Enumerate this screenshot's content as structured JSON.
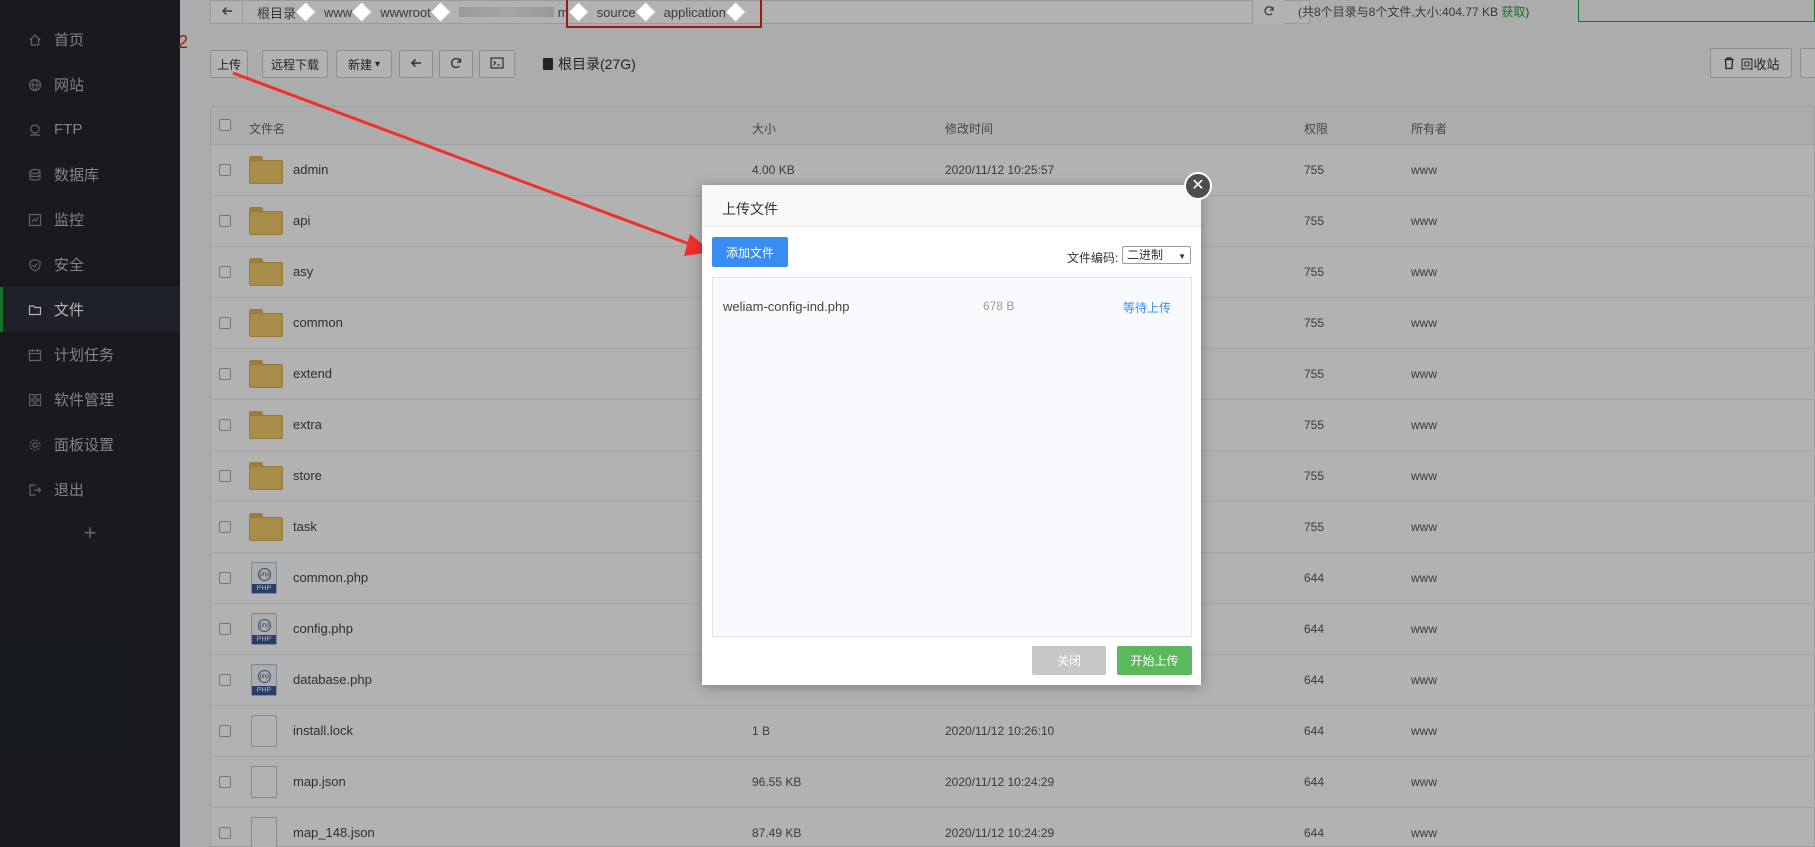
{
  "sidebar": {
    "items": [
      {
        "label": "首页",
        "icon": "home-icon"
      },
      {
        "label": "网站",
        "icon": "globe-icon"
      },
      {
        "label": "FTP",
        "icon": "ftp-icon"
      },
      {
        "label": "数据库",
        "icon": "database-icon"
      },
      {
        "label": "监控",
        "icon": "monitor-icon"
      },
      {
        "label": "安全",
        "icon": "shield-icon"
      },
      {
        "label": "文件",
        "icon": "folder-icon",
        "active": true
      },
      {
        "label": "计划任务",
        "icon": "calendar-icon"
      },
      {
        "label": "软件管理",
        "icon": "grid-icon"
      },
      {
        "label": "面板设置",
        "icon": "gear-icon"
      },
      {
        "label": "退出",
        "icon": "logout-icon"
      }
    ],
    "add_label": "+"
  },
  "breadcrumb": {
    "items": [
      "根目录",
      "www",
      "wwwroot",
      "m",
      "source",
      "application"
    ],
    "info_prefix": "(共8个目录与8个文件,大小:404.77 KB ",
    "fetch_label": "获取",
    "info_suffix": ")"
  },
  "annotation": {
    "step_number": "2"
  },
  "toolbar": {
    "upload": "上传",
    "remote_download": "远程下载",
    "new": "新建",
    "new_caret": "▾",
    "root_label": "根目录(27G)",
    "recycle": "回收站"
  },
  "table": {
    "headers": [
      "文件名",
      "大小",
      "修改时间",
      "权限",
      "所有者"
    ],
    "rows": [
      {
        "name": "admin",
        "type": "folder",
        "size": "4.00 KB",
        "mtime": "2020/11/12 10:25:57",
        "perm": "755",
        "owner": "www"
      },
      {
        "name": "api",
        "type": "folder",
        "size": "",
        "mtime": "",
        "perm": "755",
        "owner": "www"
      },
      {
        "name": "asy",
        "type": "folder",
        "size": "",
        "mtime": "",
        "perm": "755",
        "owner": "www"
      },
      {
        "name": "common",
        "type": "folder",
        "size": "",
        "mtime": "",
        "perm": "755",
        "owner": "www"
      },
      {
        "name": "extend",
        "type": "folder",
        "size": "",
        "mtime": "",
        "perm": "755",
        "owner": "www"
      },
      {
        "name": "extra",
        "type": "folder",
        "size": "",
        "mtime": "",
        "perm": "755",
        "owner": "www"
      },
      {
        "name": "store",
        "type": "folder",
        "size": "",
        "mtime": "",
        "perm": "755",
        "owner": "www"
      },
      {
        "name": "task",
        "type": "folder",
        "size": "",
        "mtime": "",
        "perm": "755",
        "owner": "www"
      },
      {
        "name": "common.php",
        "type": "php",
        "size": "",
        "mtime": "",
        "perm": "644",
        "owner": "www"
      },
      {
        "name": "config.php",
        "type": "php",
        "size": "",
        "mtime": "",
        "perm": "644",
        "owner": "www"
      },
      {
        "name": "database.php",
        "type": "php",
        "size": "",
        "mtime": "",
        "perm": "644",
        "owner": "www"
      },
      {
        "name": "install.lock",
        "type": "file",
        "size": "1 B",
        "mtime": "2020/11/12 10:26:10",
        "perm": "644",
        "owner": "www"
      },
      {
        "name": "map.json",
        "type": "file",
        "size": "96.55 KB",
        "mtime": "2020/11/12 10:24:29",
        "perm": "644",
        "owner": "www"
      },
      {
        "name": "map_148.json",
        "type": "file",
        "size": "87.49 KB",
        "mtime": "2020/11/12 10:24:29",
        "perm": "644",
        "owner": "www"
      }
    ],
    "php_badge": "PHP",
    "php_ring": "php"
  },
  "dialog": {
    "title": "上传文件",
    "add_file": "添加文件",
    "encoding_label": "文件编码:",
    "encoding_value": "二进制",
    "files": [
      {
        "name": "weliam-config-ind.php",
        "size": "678 B",
        "status": "等待上传"
      }
    ],
    "close": "关闭",
    "start_upload": "开始上传",
    "close_glyph": "✕"
  },
  "colors": {
    "sidebar_bg": "#23262e",
    "accent_green": "#20a53a",
    "primary_blue": "#3a8df0",
    "success_green": "#5cb85c",
    "annotation_red": "#e02424"
  }
}
